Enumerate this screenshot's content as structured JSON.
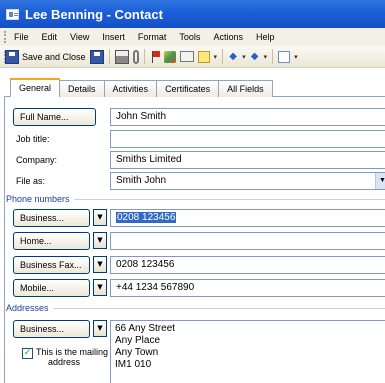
{
  "window": {
    "title": "Lee Benning - Contact"
  },
  "menu": [
    "File",
    "Edit",
    "View",
    "Insert",
    "Format",
    "Tools",
    "Actions",
    "Help"
  ],
  "toolbar": {
    "save_close_label": "Save and Close"
  },
  "tabs": [
    "General",
    "Details",
    "Activities",
    "Certificates",
    "All Fields"
  ],
  "general": {
    "full_name_button": "Full Name...",
    "full_name_value": "John Smith",
    "job_title_label": "Job title:",
    "job_title_value": "",
    "company_label": "Company:",
    "company_value": "Smiths Limited",
    "file_as_label": "File as:",
    "file_as_value": "Smith John"
  },
  "phone": {
    "section_label": "Phone numbers",
    "rows": [
      {
        "button": "Business...",
        "value": "0208 123456",
        "selected": true
      },
      {
        "button": "Home...",
        "value": ""
      },
      {
        "button": "Business Fax...",
        "value": "0208 123456"
      },
      {
        "button": "Mobile...",
        "value": "+44 1234 567890"
      }
    ]
  },
  "addresses": {
    "section_label": "Addresses",
    "button": "Business...",
    "lines": [
      "66 Any Street",
      "Any Place",
      "Any Town",
      "IM1 010"
    ],
    "mailing_checkbox_label_line1": "This is the mailing",
    "mailing_checkbox_label_line2": "address",
    "mailing_checked": true
  },
  "colors": {
    "title_bar": "#1c5ed8",
    "active_tab_accent": "#f5a623",
    "selection": "#316ac5",
    "section_text": "#1a3f9e"
  },
  "icons": [
    "contact-card-icon",
    "save-icon",
    "print-icon",
    "paperclip-icon",
    "flag-icon",
    "categories-icon",
    "envelope-icon",
    "note-icon",
    "previous-arrow-icon",
    "next-arrow-icon",
    "address-book-icon"
  ]
}
